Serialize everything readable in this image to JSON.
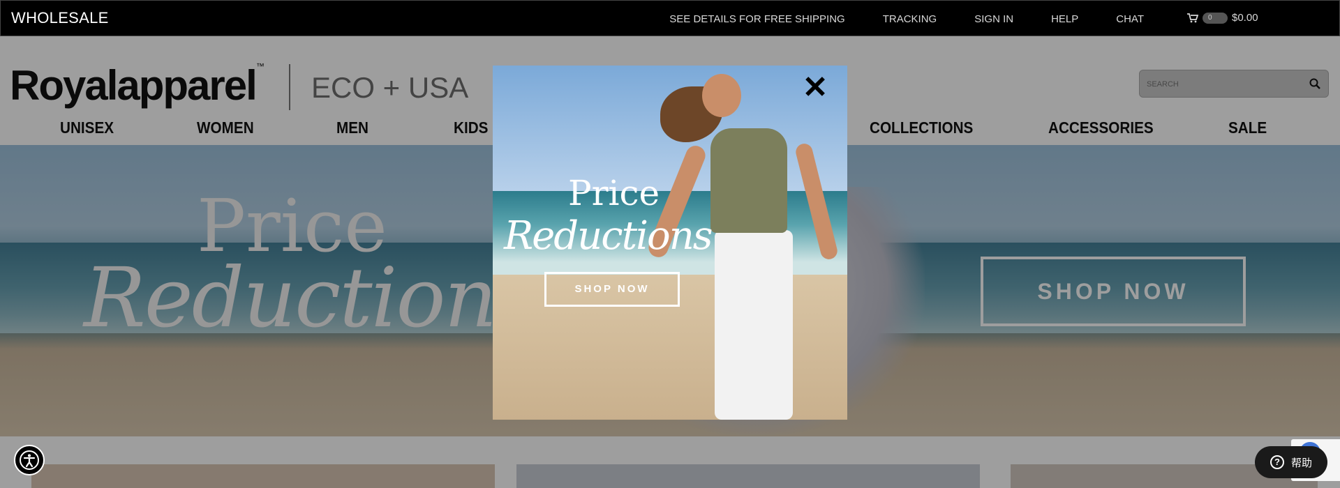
{
  "topbar": {
    "wholesale_label": "WHOLESALE",
    "links": [
      "SEE DETAILS FOR FREE SHIPPING",
      "TRACKING",
      "SIGN IN",
      "HELP",
      "CHAT"
    ],
    "cart_count": "0",
    "cart_total": "$0.00"
  },
  "header": {
    "logo_text": "Royalapparel",
    "logo_tm": "™",
    "tagline": "ECO + USA",
    "search_placeholder": "SEARCH"
  },
  "nav": {
    "items": [
      "UNISEX",
      "WOMEN",
      "MEN",
      "KIDS",
      "COLLECTIONS",
      "ACCESSORIES",
      "SALE"
    ]
  },
  "hero": {
    "headline_line1": "Price",
    "headline_line2": "Reductions",
    "cta_label": "SHOP NOW"
  },
  "modal": {
    "headline_line1": "Price",
    "headline_line2": "Reductions",
    "cta_label": "SHOP NOW",
    "close_glyph": "✕"
  },
  "help_widget": {
    "label": "帮助"
  },
  "colors": {
    "topbar_bg": "#000000",
    "overlay": "rgba(0,0,0,0.38)",
    "help_bg": "#1a1a1a"
  }
}
